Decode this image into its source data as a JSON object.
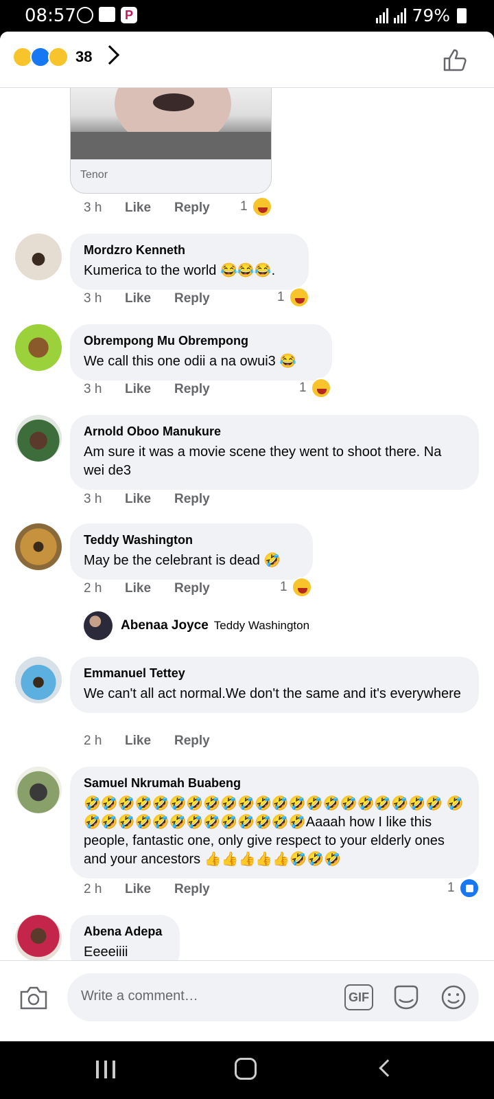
{
  "status_bar": {
    "time": "08:57",
    "battery": "79%"
  },
  "header": {
    "reaction_count": "38",
    "reactions": [
      "haha",
      "like",
      "wow"
    ]
  },
  "gif": {
    "source": "Tenor",
    "time": "3 h",
    "like": "Like",
    "reply": "Reply",
    "reaction_count": "1",
    "reaction": "haha"
  },
  "comments": [
    {
      "name": "Mordzro Kenneth",
      "text": "Kumerica to the world 😂😂😂.",
      "time": "3 h",
      "like": "Like",
      "reply": "Reply",
      "reaction_count": "1",
      "reaction": "haha"
    },
    {
      "name": "Obrempong Mu Obrempong",
      "text": "We call this one odii a na owui3 😂",
      "time": "3 h",
      "like": "Like",
      "reply": "Reply",
      "reaction_count": "1",
      "reaction": "haha"
    },
    {
      "name": "Arnold Oboo Manukure",
      "text": "Am sure it was a movie scene they went to shoot there. Na wei de3",
      "time": "3 h",
      "like": "Like",
      "reply": "Reply"
    },
    {
      "name": "Teddy Washington",
      "text": "May be the celebrant is dead 🤣",
      "time": "2 h",
      "like": "Like",
      "reply": "Reply",
      "reaction_count": "1",
      "reaction": "haha"
    },
    {
      "name": "Emmanuel Tettey",
      "text": "We can't all act normal.We don't the same and it's everywhere",
      "time": "2 h",
      "like": "Like",
      "reply": "Reply"
    },
    {
      "name": "Samuel Nkrumah Buabeng",
      "text": "🤣🤣🤣🤣🤣🤣🤣🤣🤣🤣🤣🤣🤣🤣🤣🤣🤣🤣🤣🤣🤣 🤣🤣🤣🤣🤣🤣🤣🤣🤣🤣🤣🤣🤣🤣Aaaah how I like this people, fantastic one, only give respect to your elderly ones and your ancestors 👍👍👍👍👍🤣🤣🤣",
      "time": "2 h",
      "like": "Like",
      "reply": "Reply",
      "reaction_count": "1",
      "reaction": "like"
    },
    {
      "name": "Abena Adepa",
      "text": "Eeeeiiii"
    }
  ],
  "reply_preview": {
    "name": "Abenaa Joyce",
    "tag": "Teddy Washington"
  },
  "composer": {
    "placeholder": "Write a comment…",
    "gif_label": "GIF"
  }
}
